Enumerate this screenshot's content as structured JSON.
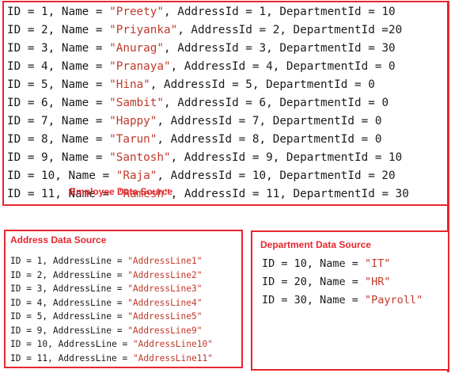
{
  "employee": {
    "caption": "Employee Data Source",
    "rows": [
      {
        "pre": "ID = 1, Name = ",
        "name": "\"Preety\"",
        "post": ", AddressId = 1, DepartmentId = 10"
      },
      {
        "pre": "ID = 2, Name = ",
        "name": "\"Priyanka\"",
        "post": ", AddressId = 2, DepartmentId =20"
      },
      {
        "pre": "ID = 3, Name = ",
        "name": "\"Anurag\"",
        "post": ", AddressId = 3, DepartmentId = 30"
      },
      {
        "pre": "ID = 4, Name = ",
        "name": "\"Pranaya\"",
        "post": ", AddressId = 4, DepartmentId = 0"
      },
      {
        "pre": "ID = 5, Name = ",
        "name": "\"Hina\"",
        "post": ", AddressId = 5, DepartmentId = 0"
      },
      {
        "pre": "ID = 6, Name = ",
        "name": "\"Sambit\"",
        "post": ", AddressId = 6, DepartmentId = 0"
      },
      {
        "pre": "ID = 7, Name = ",
        "name": "\"Happy\"",
        "post": ", AddressId = 7, DepartmentId = 0"
      },
      {
        "pre": "ID = 8, Name = ",
        "name": "\"Tarun\"",
        "post": ", AddressId = 8, DepartmentId = 0"
      },
      {
        "pre": "ID = 9, Name = ",
        "name": "\"Santosh\"",
        "post": ", AddressId = 9, DepartmentId = 10"
      },
      {
        "pre": "ID = 10, Name = ",
        "name": "\"Raja\"",
        "post": ", AddressId = 10, DepartmentId = 20"
      },
      {
        "pre": "ID = 11, Name = ",
        "name": "\"Ramesh\"",
        "post": ", AddressId = 11, DepartmentId = 30"
      }
    ]
  },
  "address": {
    "caption": "Address Data Source",
    "rows": [
      {
        "pre": "ID = 1, AddressLine = ",
        "value": "\"AddressLine1\""
      },
      {
        "pre": "ID = 2, AddressLine = ",
        "value": "\"AddressLine2\""
      },
      {
        "pre": "ID = 3, AddressLine = ",
        "value": "\"AddressLine3\""
      },
      {
        "pre": "ID = 4, AddressLine = ",
        "value": "\"AddressLine4\""
      },
      {
        "pre": "ID = 5, AddressLine = ",
        "value": "\"AddressLine5\""
      },
      {
        "pre": "ID = 9, AddressLine = ",
        "value": "\"AddressLine9\""
      },
      {
        "pre": "ID = 10, AddressLine = ",
        "value": "\"AddressLine10\""
      },
      {
        "pre": "ID = 11, AddressLine = ",
        "value": "\"AddressLine11\""
      }
    ]
  },
  "department": {
    "caption": "Department Data Source",
    "rows": [
      {
        "pre": "ID = 10, Name = ",
        "value": "\"IT\""
      },
      {
        "pre": "ID = 20, Name = ",
        "value": "\"HR\""
      },
      {
        "pre": "ID = 30, Name = ",
        "value": "\"Payroll\""
      }
    ]
  },
  "colors": {
    "border": "#e8262f",
    "string_literal": "#c0392b",
    "text": "#1a1a1a"
  }
}
